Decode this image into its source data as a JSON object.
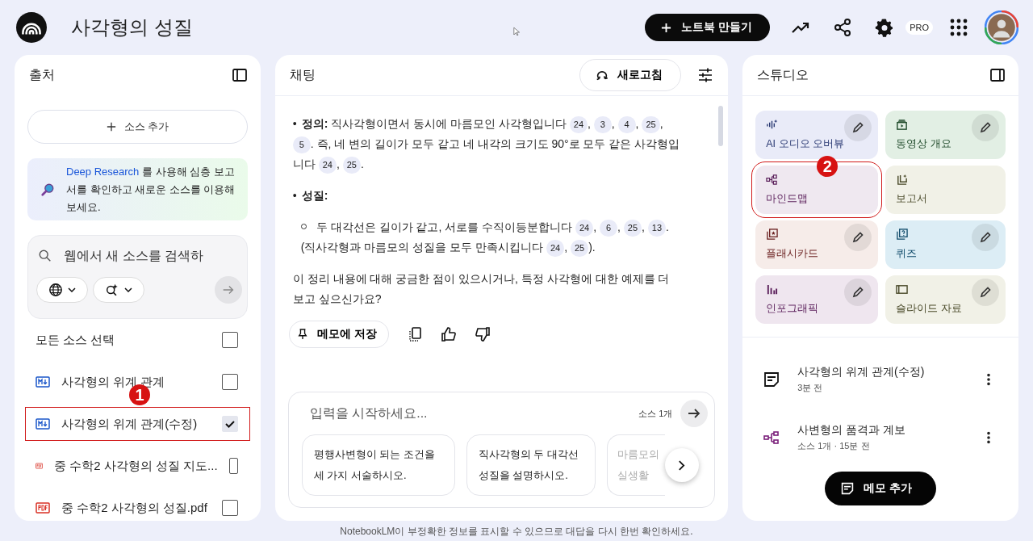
{
  "header": {
    "title": "사각형의 성질",
    "create_button": "노트북 만들기",
    "plan_badge": "PRO"
  },
  "sources": {
    "title": "출처",
    "add_button": "소스 추가",
    "promo": {
      "link": "Deep Research",
      "text": " 를 사용해 심층 보고서를 확인하고 새로운 소스를 이용해 보세요."
    },
    "search": {
      "placeholder": "웹에서 새 소스를 검색하"
    },
    "select_all": {
      "label": "모든 소스 선택",
      "checked": false
    },
    "items": [
      {
        "kind": "markdown",
        "name": "사각형의 위계 관계",
        "checked": false,
        "highlighted": false
      },
      {
        "kind": "markdown",
        "name": "사각형의 위계 관계(수정)",
        "checked": true,
        "highlighted": true,
        "marker": "1"
      },
      {
        "kind": "pdf",
        "name": "중 수학2 사각형의 성질 지도...",
        "checked": false,
        "highlighted": false
      },
      {
        "kind": "pdf",
        "name": "중 수학2 사각형의 성질.pdf",
        "checked": false,
        "highlighted": false
      }
    ]
  },
  "chat": {
    "title": "채팅",
    "refresh_button": "새로고침",
    "blocks": [
      {
        "kind": "bullet",
        "marker": "•",
        "label": "정의:",
        "parts": [
          {
            "kind": "text",
            "text": " 직사각형이면서 동시에 마름모인 사각형입니다 "
          },
          {
            "kind": "cite",
            "text": "24"
          },
          {
            "kind": "text",
            "text": ", "
          },
          {
            "kind": "cite",
            "text": "3"
          },
          {
            "kind": "text",
            "text": ", "
          },
          {
            "kind": "cite",
            "text": "4"
          },
          {
            "kind": "text",
            "text": ", "
          },
          {
            "kind": "cite",
            "text": "25"
          },
          {
            "kind": "text",
            "text": ", "
          },
          {
            "kind": "cite",
            "text": "5"
          },
          {
            "kind": "text",
            "text": ". 즉, 네 변의 길이가 모두 같고 네 내각의 크기도 90°로 모두 같은 사각형입니다 "
          },
          {
            "kind": "cite",
            "text": "24"
          },
          {
            "kind": "text",
            "text": ", "
          },
          {
            "kind": "cite",
            "text": "25"
          },
          {
            "kind": "text",
            "text": "."
          }
        ]
      },
      {
        "kind": "bullet",
        "marker": "•",
        "label": "성질:"
      },
      {
        "kind": "subbullet",
        "parts": [
          {
            "kind": "text",
            "text": "두 대각선은 길이가 같고, 서로를 수직이등분합니다 "
          },
          {
            "kind": "cite",
            "text": "24"
          },
          {
            "kind": "text",
            "text": ", "
          },
          {
            "kind": "cite",
            "text": "6"
          },
          {
            "kind": "text",
            "text": ", "
          },
          {
            "kind": "cite",
            "text": "25"
          },
          {
            "kind": "text",
            "text": ", "
          },
          {
            "kind": "cite",
            "text": "13"
          },
          {
            "kind": "text",
            "text": ". (직사각형과 마름모의 성질을 모두 만족시킵니다 "
          },
          {
            "kind": "cite",
            "text": "24"
          },
          {
            "kind": "text",
            "text": ", "
          },
          {
            "kind": "cite",
            "text": "25"
          },
          {
            "kind": "text",
            "text": ")."
          }
        ]
      },
      {
        "kind": "paragraph",
        "parts": [
          {
            "kind": "text",
            "text": "이 정리 내용에 대해 궁금한 점이 있으시거나, 특정 사각형에 대한 예제를 더 보고 싶으신가요?"
          }
        ]
      }
    ],
    "save_button": "메모에 저장",
    "input": {
      "placeholder": "입력을 시작하세요...",
      "source_count": "소스 1개"
    },
    "suggestions": [
      {
        "text": "평행사변형이 되는 조건을 세 가지 서술하시오.",
        "faded": false
      },
      {
        "text": "직사각형의 두 대각선 성질을 설명하시오.",
        "faded": false
      },
      {
        "text": "마름모의 실생활",
        "faded": true
      }
    ]
  },
  "studio": {
    "title": "스튜디오",
    "tiles": [
      {
        "kind": "audio",
        "name": "AI 오디오 오버뷰",
        "color": "#e9ebf8",
        "editable": true,
        "highlighted": false
      },
      {
        "kind": "video",
        "name": "동영상 개요",
        "color": "#e2efe4",
        "editable": true,
        "highlighted": false
      },
      {
        "kind": "mindmap",
        "name": "마인드맵",
        "color": "#efe8f0",
        "editable": false,
        "highlighted": true,
        "marker": "2"
      },
      {
        "kind": "report",
        "name": "보고서",
        "color": "#f1f1e7",
        "editable": false,
        "highlighted": false
      },
      {
        "kind": "flashcard",
        "name": "플래시카드",
        "color": "#f6ece9",
        "editable": true,
        "highlighted": false
      },
      {
        "kind": "quiz",
        "name": "퀴즈",
        "color": "#dcedf5",
        "editable": true,
        "highlighted": false
      },
      {
        "kind": "infographic",
        "name": "인포그래픽",
        "color": "#efe6ef",
        "editable": true,
        "highlighted": false
      },
      {
        "kind": "slides",
        "name": "슬라이드 자료",
        "color": "#f1f1e7",
        "editable": true,
        "highlighted": false
      }
    ],
    "notes": [
      {
        "kind": "note",
        "title": "사각형의 위계 관계(수정)",
        "meta": "3분 전"
      },
      {
        "kind": "mindmap",
        "title": "사변형의 품격과 계보",
        "meta": "소스 1개 · 15분 전"
      }
    ],
    "add_note_button": "메모 추가"
  },
  "footer": "NotebookLM이 부정확한 정보를 표시할 수 있으므로 대답을 다시 한번 확인하세요."
}
